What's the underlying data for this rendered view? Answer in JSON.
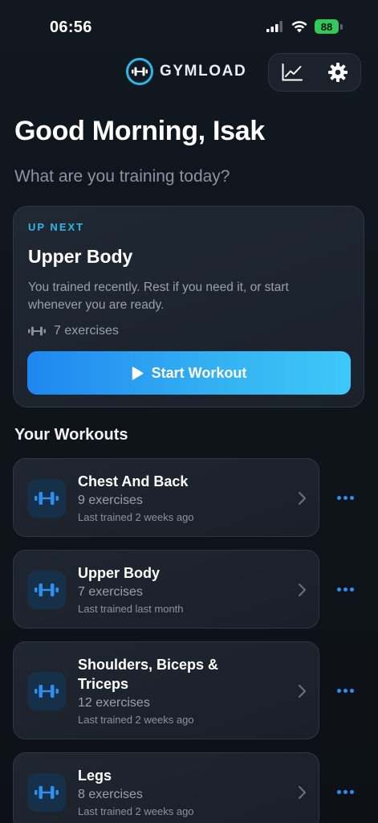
{
  "status_bar": {
    "time": "06:56",
    "battery": "88"
  },
  "header": {
    "app_name": "GYMLOAD",
    "icons": {
      "logo": "dumbbell-circle-icon",
      "stats": "chart-line-icon",
      "settings": "gear-icon"
    }
  },
  "greeting": "Good Morning, Isak",
  "subtitle": "What are you training today?",
  "up_next": {
    "kicker": "UP NEXT",
    "title": "Upper Body",
    "description": "You trained recently. Rest if you need it, or start whenever you are ready.",
    "exercise_count": "7 exercises",
    "start_label": "Start Workout"
  },
  "workouts_section": {
    "title": "Your Workouts",
    "items": [
      {
        "name": "Chest And Back",
        "count": "9 exercises",
        "last_trained": "Last trained 2 weeks ago"
      },
      {
        "name": "Upper Body",
        "count": "7 exercises",
        "last_trained": "Last trained last month"
      },
      {
        "name": "Shoulders, Biceps & Triceps",
        "count": "12 exercises",
        "last_trained": "Last trained 2 weeks ago"
      },
      {
        "name": "Legs",
        "count": "8 exercises",
        "last_trained": "Last trained 2 weeks ago"
      }
    ]
  },
  "colors": {
    "accent": "#2fb6e8",
    "button_start": "#1f86f0",
    "button_end": "#3ec8f8",
    "background": "#0e1319",
    "more_dots": "#2f8ff0"
  }
}
